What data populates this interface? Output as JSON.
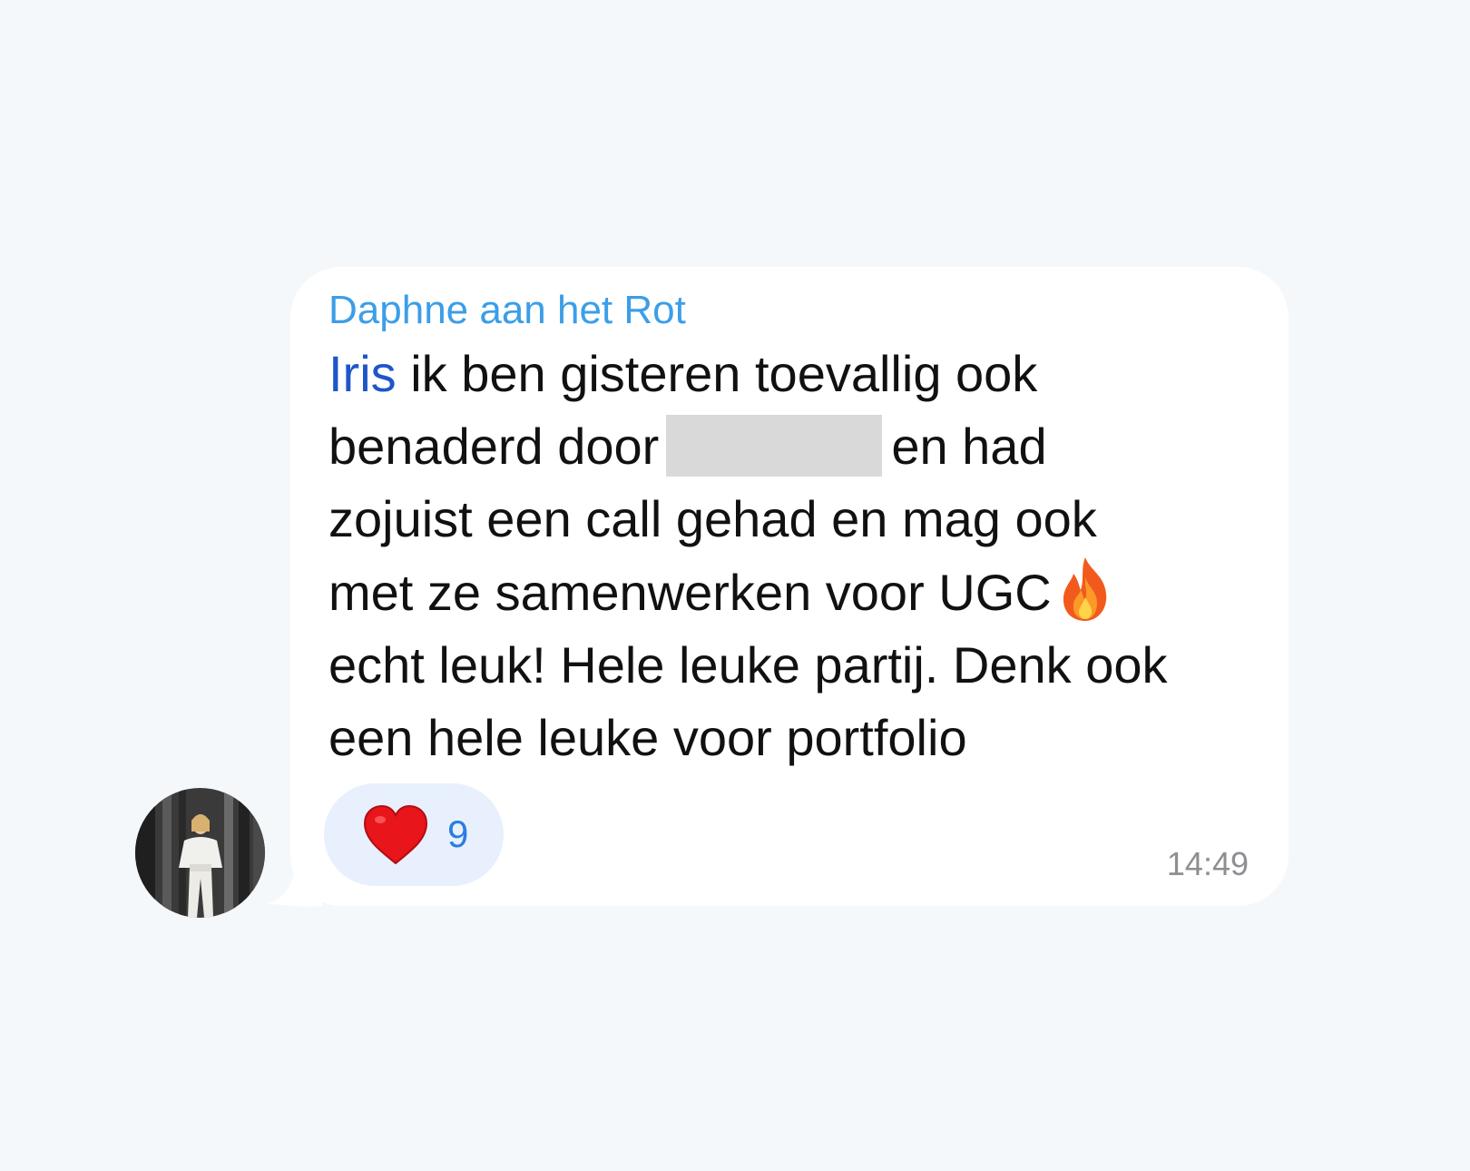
{
  "message": {
    "sender": "Daphne aan het Rot",
    "mention": "Iris",
    "line1": "ik ben gisteren toevallig ook",
    "line2_before": "benaderd door",
    "line2_after": "en had",
    "line3": "zojuist een call gehad en mag ook",
    "line4": "met ze samenwerken voor UGC",
    "line5": "echt leuk! Hele leuke partij. Denk ook",
    "line6": "een hele leuke voor portfolio",
    "timestamp": "14:49"
  },
  "reaction": {
    "emoji": "heart-emoji",
    "count": "9"
  },
  "icons": {
    "inline_emoji": "fire-emoji"
  },
  "colors": {
    "background": "#f5f8fb",
    "bubble": "#ffffff",
    "sender": "#3c9ee8",
    "mention": "#1e56c8",
    "reaction_bg": "#e7f0fc",
    "reaction_count": "#2a7de1",
    "timestamp": "#8e8e93",
    "redaction": "#d9d9d9"
  }
}
